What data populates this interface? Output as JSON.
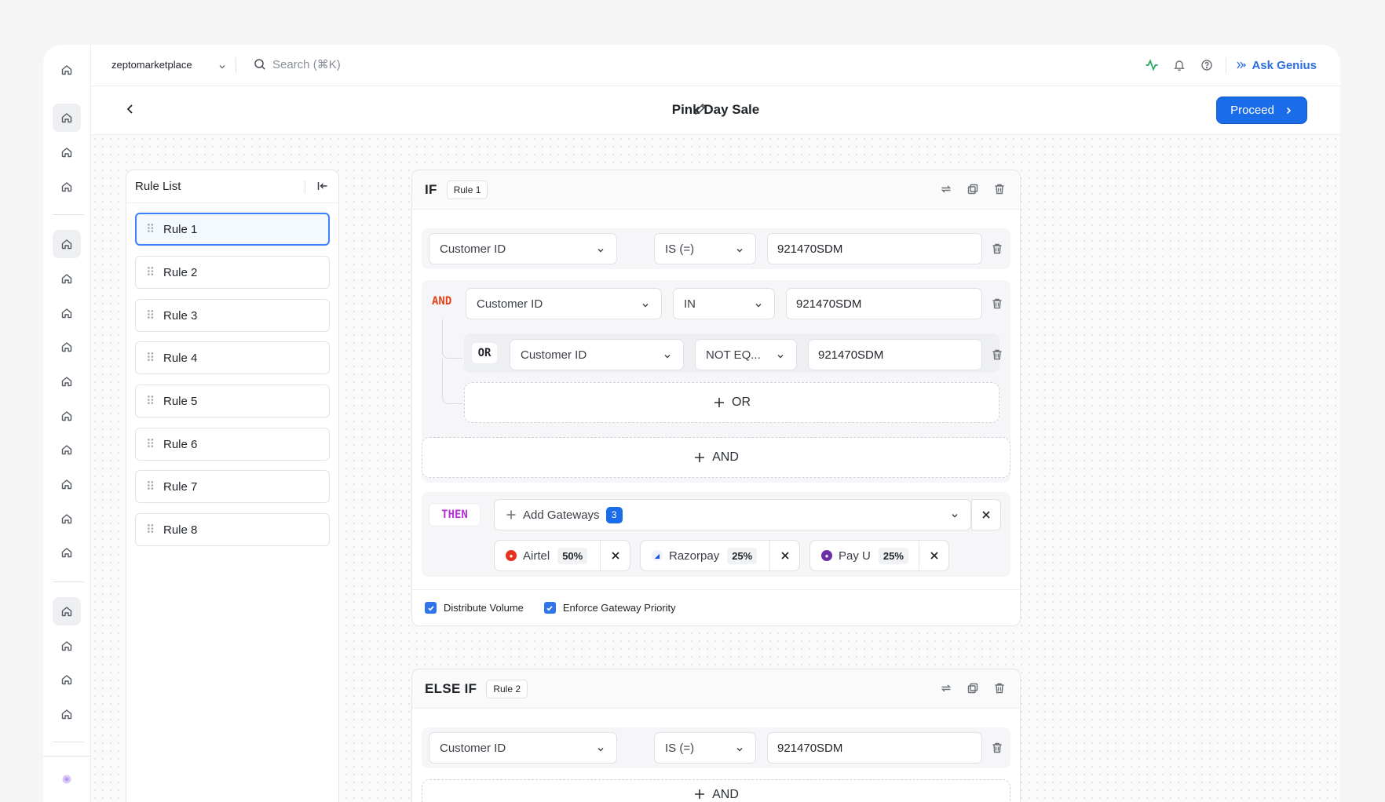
{
  "topbar": {
    "workspace": "zeptomarketplace",
    "search_placeholder": "Search  (⌘K)",
    "ask_genius": "Ask Genius"
  },
  "subheader": {
    "title": "Pink Day Sale",
    "proceed": "Proceed"
  },
  "rule_list": {
    "title": "Rule List",
    "items": [
      "Rule 1",
      "Rule 2",
      "Rule 3",
      "Rule 4",
      "Rule 5",
      "Rule 6",
      "Rule 7",
      "Rule 8"
    ]
  },
  "if_block": {
    "keyword": "IF",
    "tag": "Rule 1",
    "cond1": {
      "field": "Customer ID",
      "op": "IS (=)",
      "value": "921470SDM"
    },
    "and_label": "AND",
    "cond2": {
      "field": "Customer ID",
      "op": "IN",
      "value": "921470SDM"
    },
    "or_label": "OR",
    "cond3": {
      "field": "Customer ID",
      "op": "NOT EQ...",
      "value": "921470SDM"
    },
    "add_or": "OR",
    "add_and": "AND",
    "then_label": "THEN",
    "add_gateways": "Add Gateways",
    "gateway_count": "3",
    "gateways": [
      {
        "name": "Airtel",
        "pct": "50%",
        "color": "#e8321f"
      },
      {
        "name": "Razorpay",
        "pct": "25%",
        "color": "#1d4fd8"
      },
      {
        "name": "Pay U",
        "pct": "25%",
        "color": "#6b2fa6"
      }
    ],
    "distribute_volume": "Distribute Volume",
    "enforce_priority": "Enforce Gateway Priority"
  },
  "else_block": {
    "keyword": "ELSE IF",
    "tag": "Rule 2",
    "cond1": {
      "field": "Customer ID",
      "op": "IS (=)",
      "value": "921470SDM"
    },
    "add_and": "AND"
  },
  "colors": {
    "accent": "#1a6ce8",
    "and": "#e0441b",
    "then": "#b630d6"
  }
}
